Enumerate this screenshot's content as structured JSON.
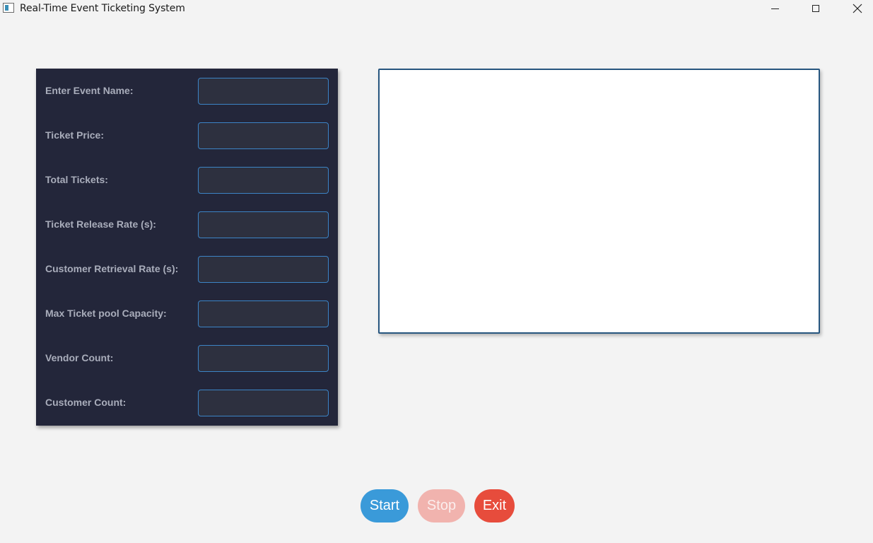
{
  "window": {
    "title": "Real-Time Event Ticketing System",
    "controls": {
      "minimize_icon": "minimize-icon",
      "maximize_icon": "maximize-icon",
      "close_icon": "close-icon",
      "close_glyph": "✕"
    }
  },
  "form": {
    "fields": [
      {
        "label": "Enter Event Name:",
        "value": "",
        "placeholder": ""
      },
      {
        "label": "Ticket Price:",
        "value": "",
        "placeholder": ""
      },
      {
        "label": "Total Tickets:",
        "value": "",
        "placeholder": ""
      },
      {
        "label": "Ticket Release Rate (s):",
        "value": "",
        "placeholder": ""
      },
      {
        "label": "Customer Retrieval Rate (s):",
        "value": "",
        "placeholder": ""
      },
      {
        "label": "Max Ticket pool Capacity:",
        "value": "",
        "placeholder": ""
      },
      {
        "label": "Vendor Count:",
        "value": "",
        "placeholder": ""
      },
      {
        "label": "Customer Count:",
        "value": "",
        "placeholder": ""
      }
    ]
  },
  "output": {
    "text": ""
  },
  "buttons": {
    "start": {
      "label": "Start",
      "enabled": true
    },
    "stop": {
      "label": "Stop",
      "enabled": false
    },
    "exit": {
      "label": "Exit",
      "enabled": true
    }
  },
  "colors": {
    "panel_bg": "#23263a",
    "input_bg": "#2d303f",
    "input_border": "#3c84c6",
    "label_text": "#a9adbb",
    "start_button": "#3a9ad9",
    "stop_button_disabled": "#f1b3ae",
    "exit_button": "#e74c3c",
    "output_border": "#27567f"
  }
}
